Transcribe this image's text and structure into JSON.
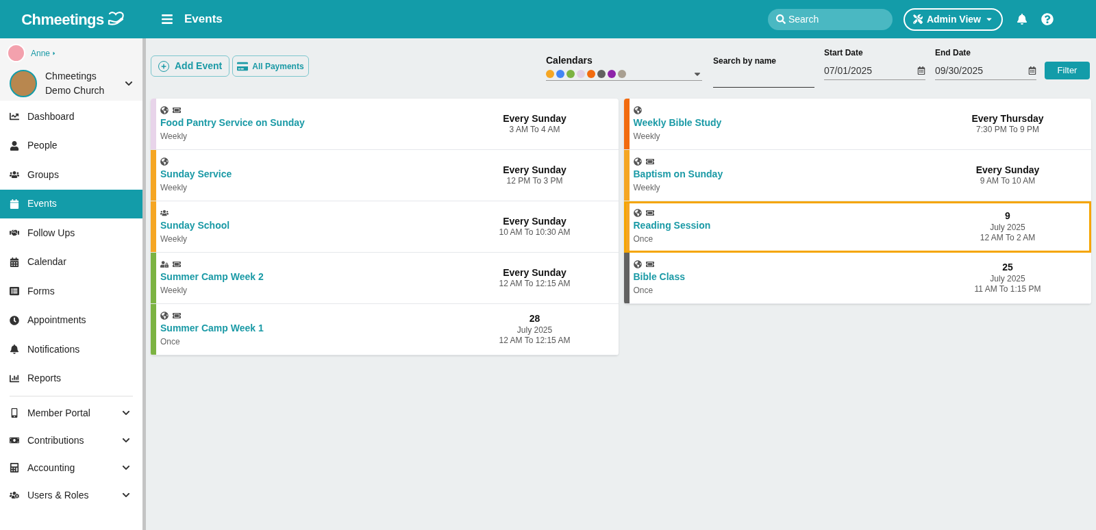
{
  "header": {
    "logo": "Chmeetings",
    "title": "Events",
    "search": {
      "placeholder": "Search"
    },
    "admin_button": "Admin View"
  },
  "sidebar": {
    "user": "Anne",
    "church": "Chmeetings Demo Church",
    "items": [
      {
        "label": "Dashboard",
        "selected": false,
        "expandable": false
      },
      {
        "label": "People",
        "selected": false,
        "expandable": false
      },
      {
        "label": "Groups",
        "selected": false,
        "expandable": false
      },
      {
        "label": "Events",
        "selected": true,
        "expandable": false
      },
      {
        "label": "Follow Ups",
        "selected": false,
        "expandable": false
      },
      {
        "label": "Calendar",
        "selected": false,
        "expandable": false
      },
      {
        "label": "Forms",
        "selected": false,
        "expandable": false
      },
      {
        "label": "Appointments",
        "selected": false,
        "expandable": false
      },
      {
        "label": "Notifications",
        "selected": false,
        "expandable": false
      },
      {
        "label": "Reports",
        "selected": false,
        "expandable": false
      },
      {
        "label": "Member Portal",
        "selected": false,
        "expandable": true
      },
      {
        "label": "Contributions",
        "selected": false,
        "expandable": true
      },
      {
        "label": "Accounting",
        "selected": false,
        "expandable": true
      },
      {
        "label": "Users & Roles",
        "selected": false,
        "expandable": true
      }
    ]
  },
  "toolbar": {
    "add_button": "Add Event",
    "payments_button": "All Payments",
    "calendars": {
      "label": "Calendars",
      "colors": [
        {
          "color": "#f5a623"
        },
        {
          "color": "#4285f4"
        },
        {
          "color": "#7cb342"
        },
        {
          "color": "#e1d0e6"
        },
        {
          "color": "#f26b0f"
        },
        {
          "color": "#616161"
        },
        {
          "color": "#8e24aa"
        },
        {
          "color": "#a89f91"
        }
      ]
    },
    "search_by_name": {
      "label": "Search by name"
    },
    "start_date": {
      "label": "Start Date",
      "value": "07/01/2025"
    },
    "end_date": {
      "label": "End Date",
      "value": "09/30/2025"
    },
    "filter_button": "Filter"
  },
  "columns": [
    [
      {
        "title": "Food Pantry Service on Sunday",
        "recurrence": "Weekly",
        "color": "#e8d4ea",
        "public": true,
        "group_only": false,
        "members_only": false,
        "tickets": true,
        "headline": "Every Sunday",
        "lines": [
          "3 AM To 4 AM"
        ],
        "selected": false
      },
      {
        "title": "Sunday Service",
        "recurrence": "Weekly",
        "color": "#f5a623",
        "public": true,
        "group_only": false,
        "members_only": false,
        "tickets": false,
        "headline": "Every Sunday",
        "lines": [
          "12 PM To 3 PM"
        ],
        "selected": false
      },
      {
        "title": "Sunday School",
        "recurrence": "Weekly",
        "color": "#f5a623",
        "public": false,
        "group_only": true,
        "members_only": false,
        "tickets": false,
        "headline": "Every Sunday",
        "lines": [
          "10 AM To 10:30 AM"
        ],
        "selected": false
      },
      {
        "title": "Summer Camp Week 2",
        "recurrence": "Weekly",
        "color": "#7cb342",
        "public": false,
        "group_only": false,
        "members_only": true,
        "tickets": true,
        "headline": "Every Sunday",
        "lines": [
          "12 AM To 12:15 AM"
        ],
        "selected": false
      },
      {
        "title": "Summer Camp Week 1",
        "recurrence": "Once",
        "color": "#7cb342",
        "public": true,
        "group_only": false,
        "members_only": false,
        "tickets": true,
        "headline": "28",
        "lines": [
          "July 2025",
          "12 AM To 12:15 AM"
        ],
        "selected": false
      }
    ],
    [
      {
        "title": "Weekly Bible Study",
        "recurrence": "Weekly",
        "color": "#f26b0f",
        "public": true,
        "group_only": false,
        "members_only": false,
        "tickets": false,
        "headline": "Every Thursday",
        "lines": [
          "7:30 PM To 9 PM"
        ],
        "selected": false
      },
      {
        "title": "Baptism on Sunday",
        "recurrence": "Weekly",
        "color": "#f5a623",
        "public": true,
        "group_only": false,
        "members_only": false,
        "tickets": true,
        "headline": "Every Sunday",
        "lines": [
          "9 AM To 10 AM"
        ],
        "selected": false
      },
      {
        "title": "Reading Session",
        "recurrence": "Once",
        "color": "#f5a623",
        "public": true,
        "group_only": false,
        "members_only": false,
        "tickets": true,
        "headline": "9",
        "lines": [
          "July 2025",
          "12 AM To 2 AM"
        ],
        "selected": true
      },
      {
        "title": "Bible Class",
        "recurrence": "Once",
        "color": "#616161",
        "public": true,
        "group_only": false,
        "members_only": false,
        "tickets": true,
        "headline": "25",
        "lines": [
          "July 2025",
          "11 AM To 1:15 PM"
        ],
        "selected": false
      }
    ]
  ]
}
